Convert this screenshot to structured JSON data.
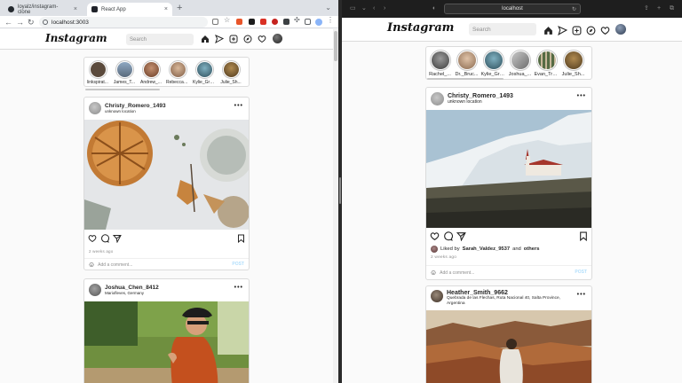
{
  "left_browser": {
    "tabs": [
      {
        "label": "loyalz/instagram-clone"
      },
      {
        "label": "React App"
      }
    ],
    "new_tab_symbol": "+",
    "url": "localhost:3003",
    "nav_symbols": {
      "back": "←",
      "forward": "→",
      "reload": "↻"
    }
  },
  "right_browser": {
    "url": "localhost"
  },
  "instagram": {
    "logo": "Instagram",
    "logo_chevron": "⌄",
    "search_placeholder": "Search",
    "post_label": "POST",
    "comment_placeholder": "Add a comment..."
  },
  "left_feed": {
    "stories": [
      {
        "name": "linkspirat...",
        "color": "#5b4a3c"
      },
      {
        "name": "James_T...",
        "color": "#6f8aa6"
      },
      {
        "name": "Andrew_...",
        "color": "#8a5a3c"
      },
      {
        "name": "Rebecca_...",
        "color": "#9c7b63"
      },
      {
        "name": "Kylie_Gre...",
        "color": "#3f6d7f"
      },
      {
        "name": "Julie_Sh...",
        "color": "#7a5a2e"
      }
    ],
    "posts": [
      {
        "username": "Christy_Romero_1493",
        "location": "unknown location",
        "time": "2 weeks ago"
      },
      {
        "username": "Joshua_Chen_8412",
        "location": "Mariofleves, Germany"
      }
    ]
  },
  "right_feed": {
    "stories": [
      {
        "name": "Rachel_...",
        "color": "#6f6f6f"
      },
      {
        "name": "Dr._Bruc...",
        "color": "#a8876b"
      },
      {
        "name": "Kylie_Gre...",
        "color": "#3f6d7f"
      },
      {
        "name": "Joshua_...",
        "color": "#8a8a8a"
      },
      {
        "name": "Evan_Tra...",
        "color": "#556b44"
      },
      {
        "name": "Julie_Sh...",
        "color": "#7a5a2e"
      }
    ],
    "posts": [
      {
        "username": "Christy_Romero_1493",
        "location": "unknown location",
        "liked_prefix": "Liked by",
        "liked_user": "Sarah_Valdez_9537",
        "liked_and": "and",
        "liked_others": "others",
        "time": "2 weeks ago"
      },
      {
        "username": "Heather_Smith_9662",
        "location": "Quebrada de las Flechas, Ruta Nacional 40, Salta Province, Argentina"
      }
    ]
  },
  "colors": {
    "chrome_tabstrip": "#dee1e6",
    "safari_bar": "#1e1e1e",
    "post_disabled": "#b2dffc",
    "border": "#dbdbdb"
  }
}
